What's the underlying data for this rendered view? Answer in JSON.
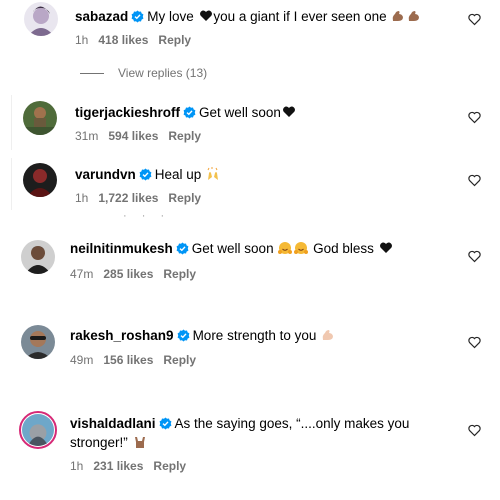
{
  "comments": [
    {
      "username": "sabazad",
      "text": "My love",
      "text2": "you a giant if I ever seen one",
      "time": "1h",
      "likes": "418 likes",
      "reply": "Reply"
    },
    {
      "username": "tigerjackieshroff",
      "text": "Get well soon",
      "time": "31m",
      "likes": "594 likes",
      "reply": "Reply"
    },
    {
      "username": "varundvn",
      "text": "Heal up",
      "time": "1h",
      "likes": "1,722 likes",
      "reply": "Reply"
    },
    {
      "username": "neilnitinmukesh",
      "text": "Get well soon",
      "text2": "God bless",
      "time": "47m",
      "likes": "285 likes",
      "reply": "Reply"
    },
    {
      "username": "rakesh_roshan9",
      "text": "More strength to you",
      "time": "49m",
      "likes": "156 likes",
      "reply": "Reply"
    },
    {
      "username": "vishaldadlani",
      "text": "As the saying goes, “....only makes you",
      "text_line2": "stronger!”",
      "time": "1h",
      "likes": "231 likes",
      "reply": "Reply"
    }
  ],
  "view_replies": "View replies (13)",
  "icons": {
    "like": "heart-outline-icon",
    "verified": "verified-badge-icon",
    "emoji_black_heart": "black-heart-emoji",
    "emoji_muscle": "flexed-biceps-emoji",
    "emoji_raised_hands": "raising-hands-emoji",
    "emoji_hug": "hugging-face-emoji",
    "emoji_horns": "sign-of-horns-emoji"
  },
  "colors": {
    "verified": "#0095f6",
    "meta": "#737373",
    "story_ring": "#d62976"
  }
}
